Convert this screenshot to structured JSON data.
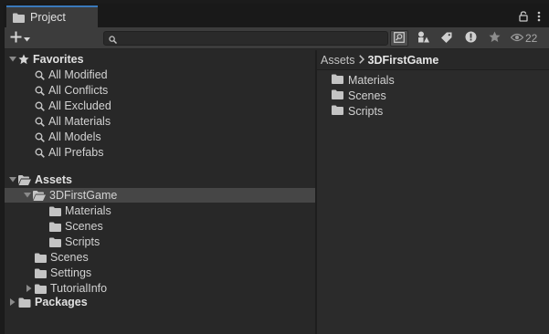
{
  "window": {
    "tab_label": "Project",
    "toolbar": {
      "add_label": "+",
      "search_placeholder": "",
      "hidden_count": "22"
    }
  },
  "tree": {
    "favorites": {
      "label": "Favorites",
      "items": [
        "All Modified",
        "All Conflicts",
        "All Excluded",
        "All Materials",
        "All Models",
        "All Prefabs"
      ]
    },
    "assets": {
      "label": "Assets",
      "first_game": "3DFirstGame",
      "first_game_children": [
        "Materials",
        "Scenes",
        "Scripts"
      ],
      "children": [
        "Scenes",
        "Settings",
        "TutorialInfo"
      ]
    },
    "packages": {
      "label": "Packages"
    }
  },
  "content": {
    "breadcrumb": {
      "root": "Assets",
      "current": "3DFirstGame"
    },
    "items": [
      "Materials",
      "Scenes",
      "Scripts"
    ]
  },
  "colors": {
    "folder": "#c4c4c4",
    "selection": "#464646",
    "tab_accent": "#3a79bb"
  }
}
